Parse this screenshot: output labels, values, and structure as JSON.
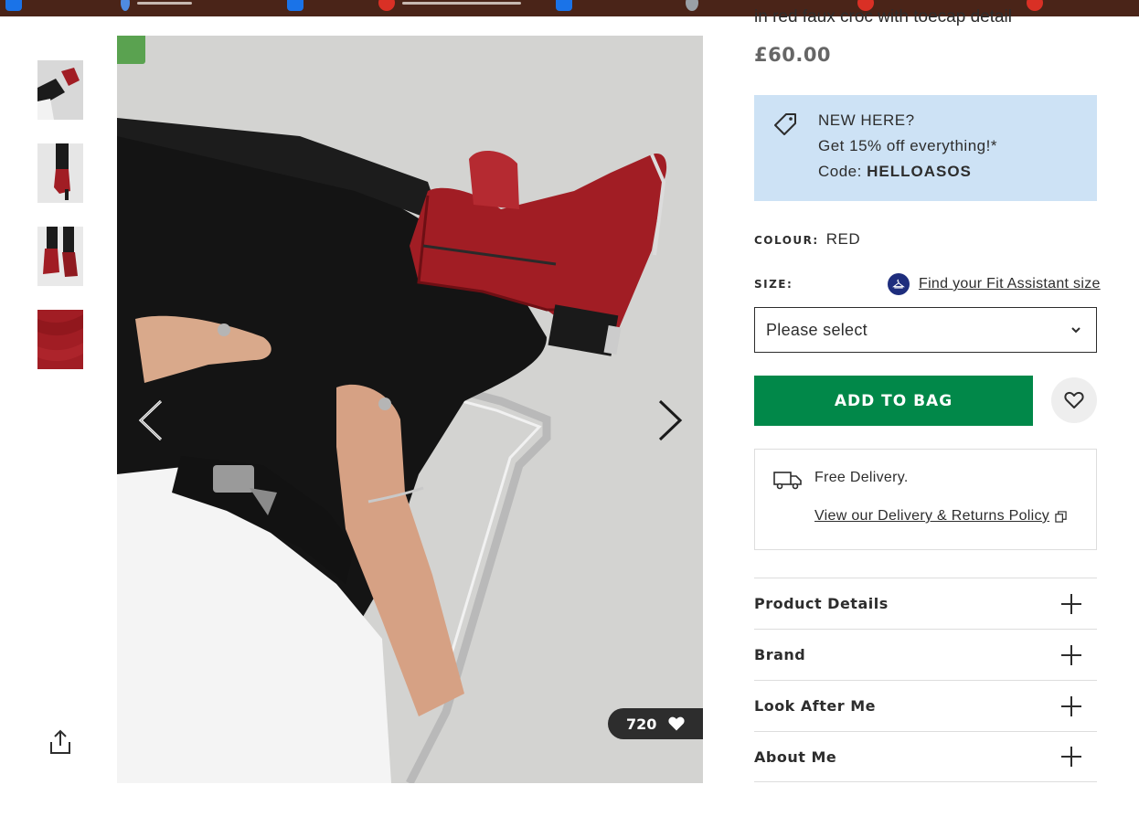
{
  "product": {
    "title": "in red faux croc with toecap detail",
    "price": "£60.00",
    "saves_count": "720"
  },
  "promo": {
    "line1": "NEW HERE?",
    "line2": "Get 15% off everything!*",
    "code_label": "Code:",
    "code": "HELLOASOS"
  },
  "colour": {
    "label": "COLOUR:",
    "value": "RED"
  },
  "size": {
    "label": "SIZE:",
    "fit_assistant_link": "Find your Fit Assistant size",
    "select_placeholder": "Please select"
  },
  "actions": {
    "add_to_bag": "ADD TO BAG"
  },
  "delivery": {
    "text": "Free Delivery.",
    "policy_link": "View our Delivery & Returns Policy"
  },
  "accordion": [
    {
      "label": "Product Details"
    },
    {
      "label": "Brand"
    },
    {
      "label": "Look After Me"
    },
    {
      "label": "About Me"
    }
  ],
  "colors": {
    "add_to_bag_green": "#018849",
    "promo_blue": "#cde2f5",
    "boot_red": "#a11d24"
  },
  "icons": {
    "gallery_prev": "chevron-left-icon",
    "gallery_next": "chevron-right-icon",
    "share": "share-icon",
    "wishlist": "heart-outline-icon",
    "saves": "heart-filled-icon",
    "promo": "price-tag-icon",
    "delivery": "truck-icon",
    "fit_assistant": "hanger-icon",
    "select": "chevron-down-icon",
    "policy_link": "external-link-icon",
    "accordion": "plus-icon"
  }
}
